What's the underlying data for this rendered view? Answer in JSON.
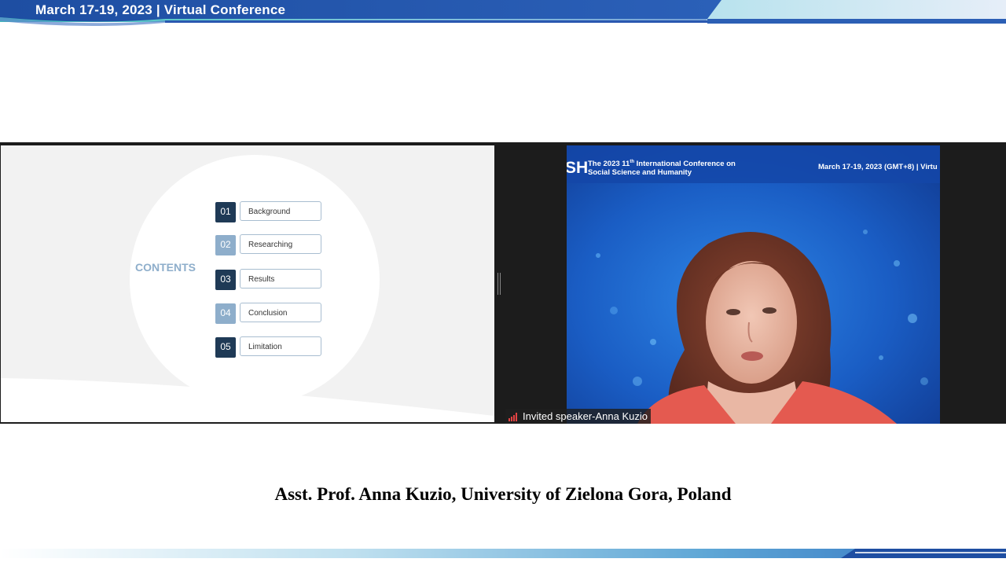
{
  "banner": {
    "date_text": "March 17-19, 2023  | Virtual Conference"
  },
  "slide": {
    "contents_title": "CONTENTS",
    "items": [
      {
        "num": "01",
        "label": "Background",
        "style": "dark"
      },
      {
        "num": "02",
        "label": "Researching",
        "style": "light"
      },
      {
        "num": "03",
        "label": "Results",
        "style": "dark"
      },
      {
        "num": "04",
        "label": "Conclusion",
        "style": "light"
      },
      {
        "num": "05",
        "label": "Limitation",
        "style": "dark"
      }
    ]
  },
  "video": {
    "logo": "SH",
    "conference_line1": "The 2023 11",
    "conference_line1_sup": "th",
    "conference_line1_rest": " International Conference on",
    "conference_line2": "Social Science and Humanity",
    "date": "March 17-19, 2023 (GMT+8) | Virtu",
    "speaker_name": "Invited speaker-Anna Kuzio",
    "signal_icon": "signal-bars-icon"
  },
  "caption": "Asst. Prof. Anna Kuzio, University of Zielona Gora, Poland",
  "colors": {
    "banner_blue": "#1f4ea3",
    "slide_dark": "#1f3a56",
    "slide_light": "#8eaecb",
    "video_blue": "#1a5dc4",
    "signal_red": "#e34343"
  }
}
